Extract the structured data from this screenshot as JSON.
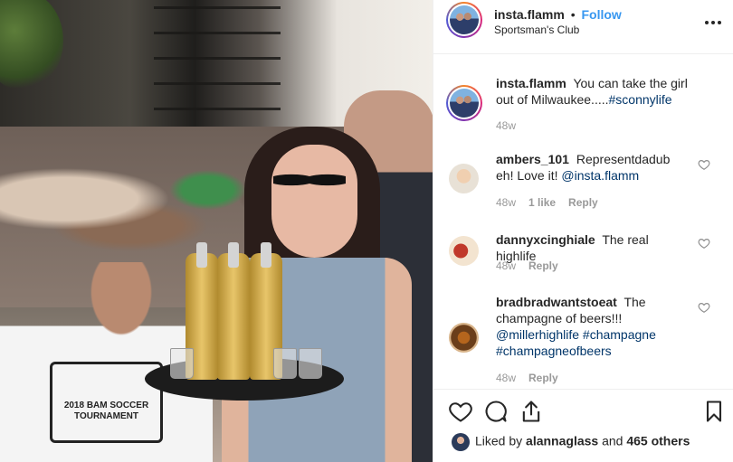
{
  "post": {
    "username": "insta.flamm",
    "follow_label": "Follow",
    "separator": "•",
    "location": "Sportsman's Club",
    "more_label": "•••"
  },
  "photo": {
    "shirt_text": "2018 BAM SOCCER TOURNAMENT"
  },
  "caption": {
    "username": "insta.flamm",
    "text": "You can take the girl out of Milwaukee.....",
    "hashtag": "#sconnylife",
    "time": "48w"
  },
  "comments": [
    {
      "username": "ambers_101",
      "text": "Representdadub eh! Love it!",
      "mention": "@insta.flamm",
      "time": "48w",
      "likes": "1 like",
      "reply_label": "Reply"
    },
    {
      "username": "dannyxcinghiale",
      "text": "The real highlife",
      "time": "48w",
      "reply_label": "Reply"
    },
    {
      "username": "bradbradwantstoeat",
      "text": "The champagne of beers!!!",
      "tags": "@millerhighlife #champagne #champagneofbeers",
      "time": "48w",
      "reply_label": "Reply"
    }
  ],
  "actions": {
    "liked_by_prefix": "Liked by",
    "liked_by_user": "alannaglass",
    "liked_by_and": "and",
    "liked_by_others": "465 others"
  },
  "icons": {
    "like": "heart-icon",
    "comment": "comment-icon",
    "share": "share-icon",
    "save": "bookmark-icon",
    "more": "more-icon"
  },
  "colors": {
    "link": "#3897f0",
    "tag": "#003569",
    "meta": "#999999",
    "divider": "#efefef",
    "text": "#262626"
  }
}
